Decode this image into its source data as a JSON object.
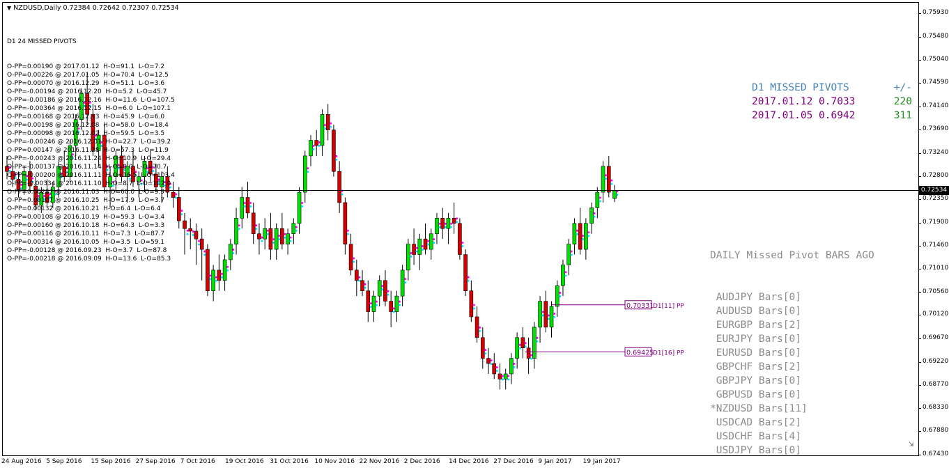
{
  "symbol_header": {
    "text": "NZDUSD,Daily  0.72384 0.72642 0.72307 0.72534"
  },
  "missed_pivots_list": {
    "title": "D1 24 MISSED PIVOTS",
    "lines": [
      "O-PP=0.00190 @ 2017.01.12  H-O=91.1  L-O=7.2",
      "O-PP=0.00226 @ 2017.01.05  H-O=70.4  L-O=12.5",
      "O-PP=0.00070 @ 2016.12.29  H-O=51.1  L-O=3.6",
      "O-PP=-0.00194 @ 2016.12.20  H-O=5.2  L-O=45.7",
      "O-PP=-0.00186 @ 2016.12.16  H-O=11.6  L-O=107.5",
      "O-PP=-0.00364 @ 2016.12.15  H-O=6.0  L-O=107.1",
      "O-PP=0.00168 @ 2016.12.13  H-O=45.9  L-O=6.0",
      "O-PP=0.00198 @ 2016.12.08  H-O=58.0  L-O=18.4",
      "O-PP=0.00098 @ 2016.12.02  H-O=59.5  L-O=3.5",
      "O-PP=-0.00246 @ 2016.12.01  H-O=22.7  L-O=39.2",
      "O-PP=0.00147 @ 2016.11.28  H-O=57.3  L-O=11.9",
      "O-PP=-0.00243 @ 2016.11.24  H-O=10.9  L-O=29.4",
      "O-PP=-0.00137 @ 2016.11.14  H-O=0.0  L-O=70.7",
      "O-PP=-0.00200 @ 2016.11.11  H-O=16.5  L-O=103.4",
      "O-PP=-0.00334 @ 2016.11.10  H-O=8.7  L-O=102.0",
      "O-PP=0.00287 @ 2016.11.03  H-O=60.0  L-O=9.9",
      "O-PP=0.00107 @ 2016.10.25  H-O=17.9  L-O=3.7",
      "O-PP=0.00132 @ 2016.10.21  H-O=6.4  L-O=6.4",
      "O-PP=0.00108 @ 2016.10.19  H-O=59.3  L-O=3.4",
      "O-PP=0.00160 @ 2016.10.18  H-O=64.3  L-O=3.3",
      "O-PP=0.00116 @ 2016.10.11  H-O=7.3  L-O=87.7",
      "O-PP=0.00314 @ 2016.10.05  H-O=3.5  L-O=59.1",
      "O-PP=-0.00128 @ 2016.09.23  H-O=3.7  L-O=87.8",
      "O-PP=-0.00218 @ 2016.09.09  H-O=13.6  L-O=85.3"
    ]
  },
  "missed_pivots_panel": {
    "title": "D1 MISSED PIVOTS",
    "col_header": "+/-",
    "rows": [
      {
        "date_price": "2017.01.12 0.7033",
        "diff": "220"
      },
      {
        "date_price": "2017.01.05 0.6942",
        "diff": "311"
      }
    ],
    "colors": {
      "title": "#4682b4",
      "row": "#800080",
      "diff": "#228b22"
    }
  },
  "bars_ago_panel": {
    "title": "DAILY Missed Pivot BARS AGO",
    "items": [
      " AUDJPY Bars[0]",
      " AUDUSD Bars[0]",
      " EURGBP Bars[2]",
      " EURJPY Bars[0]",
      " EURUSD Bars[0]",
      " GBPCHF Bars[2]",
      " GBPJPY Bars[0]",
      " GBPUSD Bars[0]",
      "*NZDUSD Bars[11]",
      " USDCAD Bars[2]",
      " USDCHF Bars[4]",
      " USDJPY Bars[0]"
    ]
  },
  "pivot_labels": [
    {
      "value": "0.70331",
      "tag": "D1[11] PP"
    },
    {
      "value": "0.69425",
      "tag": "D1[16] PP"
    }
  ],
  "current_price_label": "0.72534",
  "y_axis_ticks": [
    "0.75930",
    "0.75480",
    "0.75040",
    "0.74590",
    "0.74140",
    "0.73690",
    "0.73240",
    "0.72800",
    "0.72350",
    "0.71900",
    "0.71460",
    "0.71010",
    "0.70560",
    "0.70120",
    "0.69670",
    "0.69220",
    "0.68770",
    "0.68330",
    "0.67880",
    "0.67430"
  ],
  "x_axis_ticks": [
    "24 Aug 2016",
    "5 Sep 2016",
    "15 Sep 2016",
    "27 Sep 2016",
    "7 Oct 2016",
    "19 Oct 2016",
    "31 Oct 2016",
    "10 Nov 2016",
    "22 Nov 2016",
    "2 Dec 2016",
    "14 Dec 2016",
    "27 Dec 2016",
    "9 Jan 2017",
    "19 Jan 2017"
  ],
  "chart_data": {
    "type": "candlestick",
    "symbol": "NZDUSD",
    "timeframe": "Daily",
    "ylim": [
      0.6743,
      0.7615
    ],
    "last": {
      "open": 0.72384,
      "high": 0.72642,
      "low": 0.72307,
      "close": 0.72534
    },
    "candles": [
      [
        0.73,
        0.732,
        0.7275,
        0.729
      ],
      [
        0.729,
        0.731,
        0.726,
        0.7275
      ],
      [
        0.7275,
        0.729,
        0.724,
        0.7255
      ],
      [
        0.7255,
        0.73,
        0.7245,
        0.729
      ],
      [
        0.729,
        0.731,
        0.725,
        0.7262
      ],
      [
        0.7262,
        0.728,
        0.7215,
        0.7225
      ],
      [
        0.7225,
        0.726,
        0.721,
        0.725
      ],
      [
        0.725,
        0.7275,
        0.7225,
        0.723
      ],
      [
        0.723,
        0.727,
        0.722,
        0.726
      ],
      [
        0.726,
        0.731,
        0.724,
        0.73
      ],
      [
        0.73,
        0.733,
        0.727,
        0.728
      ],
      [
        0.728,
        0.735,
        0.727,
        0.734
      ],
      [
        0.734,
        0.74,
        0.732,
        0.739
      ],
      [
        0.739,
        0.745,
        0.737,
        0.744
      ],
      [
        0.744,
        0.748,
        0.738,
        0.74
      ],
      [
        0.74,
        0.742,
        0.732,
        0.733
      ],
      [
        0.733,
        0.737,
        0.73,
        0.736
      ],
      [
        0.736,
        0.738,
        0.725,
        0.726
      ],
      [
        0.726,
        0.73,
        0.722,
        0.728
      ],
      [
        0.728,
        0.733,
        0.725,
        0.732
      ],
      [
        0.732,
        0.734,
        0.727,
        0.728
      ],
      [
        0.728,
        0.731,
        0.723,
        0.73
      ],
      [
        0.73,
        0.733,
        0.726,
        0.727
      ],
      [
        0.727,
        0.729,
        0.724,
        0.728
      ],
      [
        0.728,
        0.732,
        0.725,
        0.731
      ],
      [
        0.731,
        0.733,
        0.727,
        0.7285
      ],
      [
        0.7285,
        0.7305,
        0.725,
        0.726
      ],
      [
        0.726,
        0.729,
        0.723,
        0.728
      ],
      [
        0.728,
        0.73,
        0.724,
        0.725
      ],
      [
        0.725,
        0.727,
        0.722,
        0.724
      ],
      [
        0.724,
        0.726,
        0.718,
        0.7195
      ],
      [
        0.7195,
        0.721,
        0.713,
        0.718
      ],
      [
        0.718,
        0.72,
        0.714,
        0.7175
      ],
      [
        0.7175,
        0.719,
        0.711,
        0.716
      ],
      [
        0.716,
        0.718,
        0.708,
        0.714
      ],
      [
        0.714,
        0.715,
        0.705,
        0.706
      ],
      [
        0.706,
        0.711,
        0.704,
        0.71
      ],
      [
        0.71,
        0.713,
        0.706,
        0.708
      ],
      [
        0.708,
        0.713,
        0.706,
        0.712
      ],
      [
        0.712,
        0.716,
        0.71,
        0.715
      ],
      [
        0.715,
        0.722,
        0.713,
        0.72
      ],
      [
        0.72,
        0.726,
        0.718,
        0.724
      ],
      [
        0.724,
        0.727,
        0.72,
        0.721
      ],
      [
        0.721,
        0.723,
        0.715,
        0.717
      ],
      [
        0.717,
        0.719,
        0.713,
        0.716
      ],
      [
        0.716,
        0.72,
        0.714,
        0.718
      ],
      [
        0.718,
        0.721,
        0.712,
        0.714
      ],
      [
        0.714,
        0.719,
        0.712,
        0.718
      ],
      [
        0.718,
        0.721,
        0.714,
        0.715
      ],
      [
        0.715,
        0.718,
        0.713,
        0.717
      ],
      [
        0.717,
        0.72,
        0.715,
        0.719
      ],
      [
        0.719,
        0.726,
        0.717,
        0.725
      ],
      [
        0.725,
        0.733,
        0.723,
        0.732
      ],
      [
        0.732,
        0.736,
        0.73,
        0.735
      ],
      [
        0.735,
        0.737,
        0.732,
        0.734
      ],
      [
        0.734,
        0.741,
        0.732,
        0.74
      ],
      [
        0.74,
        0.742,
        0.735,
        0.737
      ],
      [
        0.737,
        0.738,
        0.728,
        0.729
      ],
      [
        0.729,
        0.731,
        0.721,
        0.723
      ],
      [
        0.723,
        0.724,
        0.713,
        0.715
      ],
      [
        0.715,
        0.717,
        0.709,
        0.71
      ],
      [
        0.71,
        0.712,
        0.705,
        0.708
      ],
      [
        0.708,
        0.71,
        0.705,
        0.706
      ],
      [
        0.706,
        0.708,
        0.7,
        0.702
      ],
      [
        0.702,
        0.706,
        0.7,
        0.705
      ],
      [
        0.705,
        0.709,
        0.703,
        0.708
      ],
      [
        0.708,
        0.71,
        0.703,
        0.704
      ],
      [
        0.704,
        0.706,
        0.699,
        0.702
      ],
      [
        0.702,
        0.706,
        0.7,
        0.705
      ],
      [
        0.705,
        0.711,
        0.703,
        0.71
      ],
      [
        0.71,
        0.716,
        0.708,
        0.715
      ],
      [
        0.715,
        0.718,
        0.711,
        0.713
      ],
      [
        0.713,
        0.717,
        0.71,
        0.716
      ],
      [
        0.716,
        0.719,
        0.713,
        0.714
      ],
      [
        0.714,
        0.718,
        0.712,
        0.717
      ],
      [
        0.717,
        0.721,
        0.715,
        0.72
      ],
      [
        0.72,
        0.722,
        0.716,
        0.718
      ],
      [
        0.718,
        0.721,
        0.715,
        0.72
      ],
      [
        0.72,
        0.723,
        0.717,
        0.719
      ],
      [
        0.719,
        0.72,
        0.712,
        0.713
      ],
      [
        0.713,
        0.714,
        0.705,
        0.706
      ],
      [
        0.706,
        0.708,
        0.7,
        0.701
      ],
      [
        0.701,
        0.703,
        0.696,
        0.697
      ],
      [
        0.697,
        0.699,
        0.691,
        0.693
      ],
      [
        0.693,
        0.695,
        0.69,
        0.692
      ],
      [
        0.692,
        0.694,
        0.689,
        0.69
      ],
      [
        0.69,
        0.692,
        0.687,
        0.689
      ],
      [
        0.689,
        0.691,
        0.687,
        0.69
      ],
      [
        0.69,
        0.694,
        0.688,
        0.693
      ],
      [
        0.693,
        0.698,
        0.691,
        0.697
      ],
      [
        0.697,
        0.699,
        0.693,
        0.695
      ],
      [
        0.695,
        0.697,
        0.69,
        0.693
      ],
      [
        0.693,
        0.7,
        0.691,
        0.699
      ],
      [
        0.699,
        0.705,
        0.696,
        0.704
      ],
      [
        0.704,
        0.706,
        0.698,
        0.699
      ],
      [
        0.699,
        0.704,
        0.697,
        0.703
      ],
      [
        0.703,
        0.708,
        0.701,
        0.707
      ],
      [
        0.707,
        0.712,
        0.705,
        0.711
      ],
      [
        0.711,
        0.716,
        0.709,
        0.715
      ],
      [
        0.715,
        0.72,
        0.713,
        0.719
      ],
      [
        0.719,
        0.722,
        0.713,
        0.714
      ],
      [
        0.714,
        0.72,
        0.712,
        0.719
      ],
      [
        0.719,
        0.723,
        0.717,
        0.722
      ],
      [
        0.722,
        0.726,
        0.72,
        0.725
      ],
      [
        0.725,
        0.731,
        0.723,
        0.73
      ],
      [
        0.73,
        0.732,
        0.724,
        0.725
      ],
      [
        0.7238,
        0.7264,
        0.7231,
        0.7253
      ]
    ],
    "horizontal_lines": [
      0.72534
    ],
    "pivot_levels": [
      0.70331,
      0.69425
    ]
  }
}
